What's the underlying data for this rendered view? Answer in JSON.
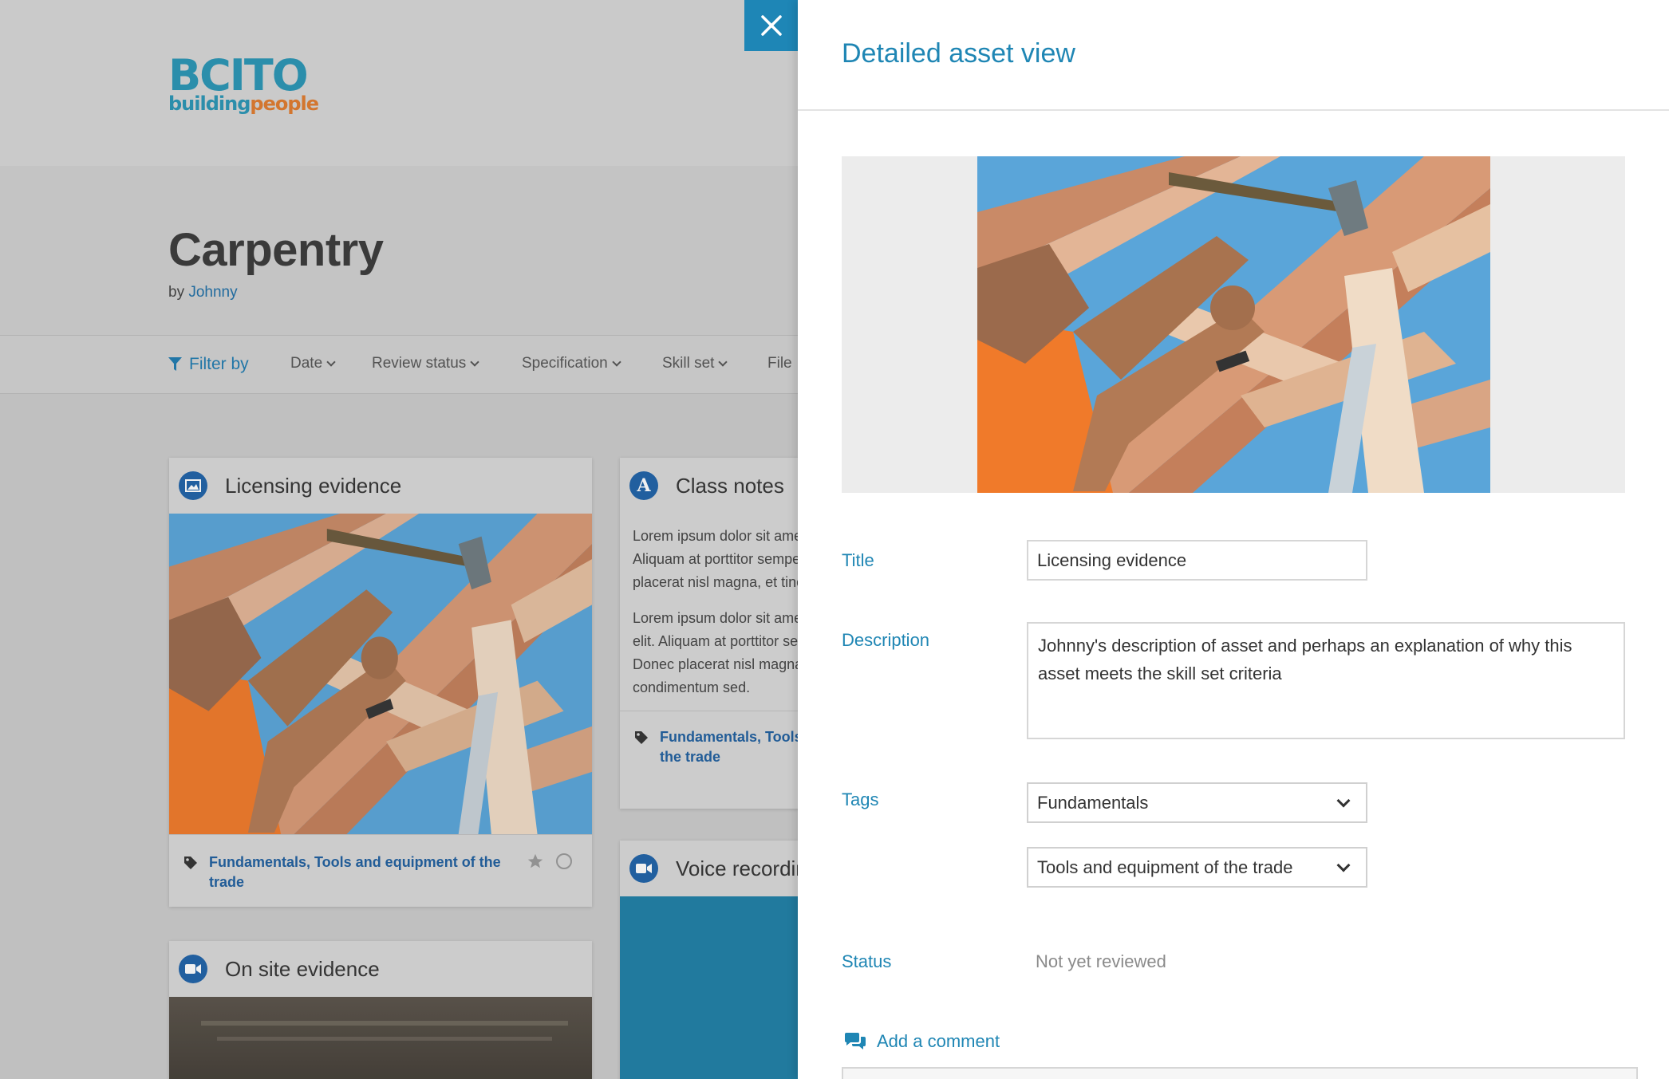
{
  "brand": {
    "logo_main": "BCITO",
    "logo_sub_a": "building",
    "logo_sub_b": "people"
  },
  "project": {
    "title": "Carpentry",
    "by_prefix": "by",
    "author": "Johnny"
  },
  "filters": {
    "filter_by_label": "Filter by",
    "items": [
      "Date",
      "Review status",
      "Specification",
      "Skill set",
      "File"
    ]
  },
  "cards": [
    {
      "title": "Licensing evidence",
      "icon": "image-icon",
      "tags": "Fundamentals, Tools and equipment of the trade"
    },
    {
      "title": "Class notes",
      "icon": "text-icon",
      "para1_lines": [
        "Lorem ipsum dolor sit amet,",
        "Aliquam at porttitor semper",
        "placerat nisl magna, et tincidunt"
      ],
      "para2_lines": [
        "Lorem ipsum dolor sit amet, consectetur",
        "elit. Aliquam at porttitor semper.",
        "Donec placerat nisl magna, et",
        "condimentum sed."
      ],
      "tags_line1": "Fundamentals, Tools and equipment of",
      "tags_line2": "the trade"
    },
    {
      "title": "Voice recording",
      "icon": "video-icon"
    },
    {
      "title": "On site evidence",
      "icon": "video-icon"
    }
  ],
  "drawer": {
    "title": "Detailed asset view",
    "close_icon": "close-icon",
    "fields": {
      "title_label": "Title",
      "title_value": "Licensing evidence",
      "description_label": "Description",
      "description_value": "Johnny's description of asset and perhaps an explanation of why this asset meets the skill set criteria",
      "tags_label": "Tags",
      "tag1": "Fundamentals",
      "tag2": "Tools and equipment of the trade",
      "status_label": "Status",
      "status_value": "Not yet reviewed"
    },
    "add_comment": "Add a comment"
  },
  "colors": {
    "accent": "#1f86b4",
    "close_bg": "#1e86b6",
    "icon_blue": "#1f62a8",
    "logo_orange": "#e07b2e"
  }
}
